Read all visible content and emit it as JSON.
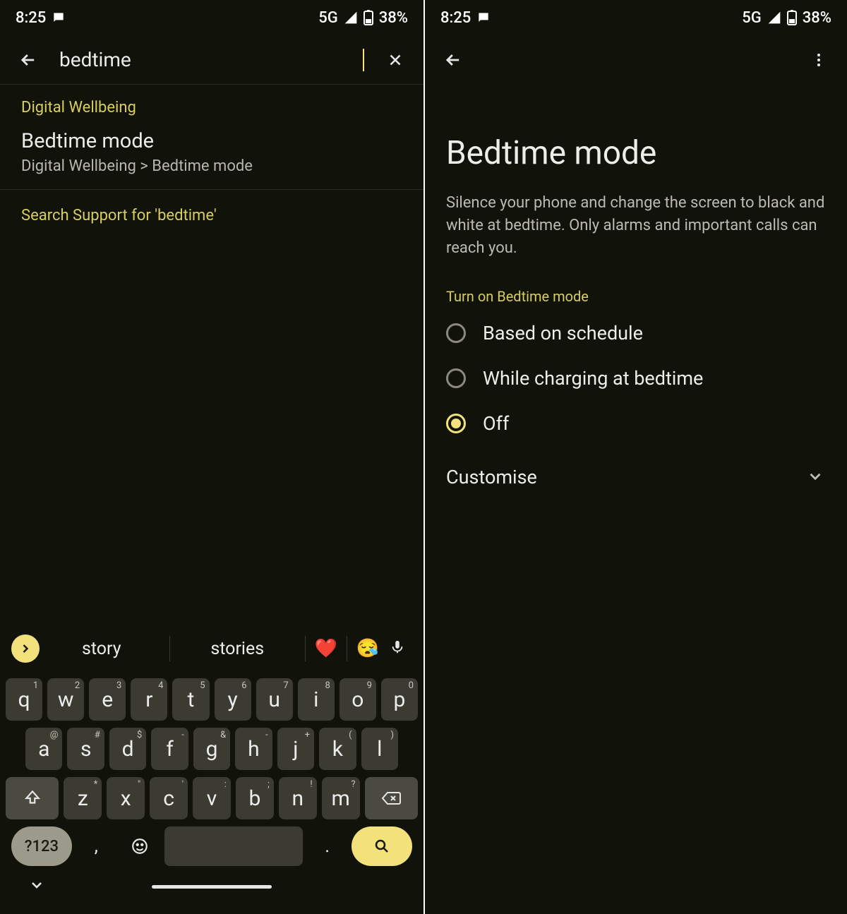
{
  "status": {
    "time": "8:25",
    "net": "5G",
    "battery": "38%"
  },
  "left": {
    "search_value": "bedtime",
    "category": "Digital Wellbeing",
    "result_title": "Bedtime mode",
    "result_path": "Digital Wellbeing > Bedtime mode",
    "support": "Search Support for 'bedtime'",
    "suggestions": {
      "w1": "story",
      "w2": "stories",
      "e1": "❤️",
      "e2": "😪"
    },
    "keys_r1": [
      {
        "m": "q",
        "s": "1"
      },
      {
        "m": "w",
        "s": "2"
      },
      {
        "m": "e",
        "s": "3"
      },
      {
        "m": "r",
        "s": "4"
      },
      {
        "m": "t",
        "s": "5"
      },
      {
        "m": "y",
        "s": "6"
      },
      {
        "m": "u",
        "s": "7"
      },
      {
        "m": "i",
        "s": "8"
      },
      {
        "m": "o",
        "s": "9"
      },
      {
        "m": "p",
        "s": "0"
      }
    ],
    "keys_r2": [
      {
        "m": "a",
        "s": "@"
      },
      {
        "m": "s",
        "s": "#"
      },
      {
        "m": "d",
        "s": "$"
      },
      {
        "m": "f",
        "s": "-"
      },
      {
        "m": "g",
        "s": "&"
      },
      {
        "m": "h",
        "s": "-"
      },
      {
        "m": "j",
        "s": "+"
      },
      {
        "m": "k",
        "s": "("
      },
      {
        "m": "l",
        "s": ")"
      }
    ],
    "keys_r3": [
      {
        "m": "z",
        "s": "*"
      },
      {
        "m": "x",
        "s": "\""
      },
      {
        "m": "c",
        "s": "'"
      },
      {
        "m": "v",
        "s": ":"
      },
      {
        "m": "b",
        "s": ";"
      },
      {
        "m": "n",
        "s": "!"
      },
      {
        "m": "m",
        "s": "?"
      }
    ],
    "sym": "?123",
    "comma": ",",
    "dot": "."
  },
  "right": {
    "title": "Bedtime mode",
    "desc": "Silence your phone and change the screen to black and white at bedtime. Only alarms and important calls can reach you.",
    "section": "Turn on Bedtime mode",
    "opt1": "Based on schedule",
    "opt2": "While charging at bedtime",
    "opt3": "Off",
    "customise": "Customise"
  }
}
